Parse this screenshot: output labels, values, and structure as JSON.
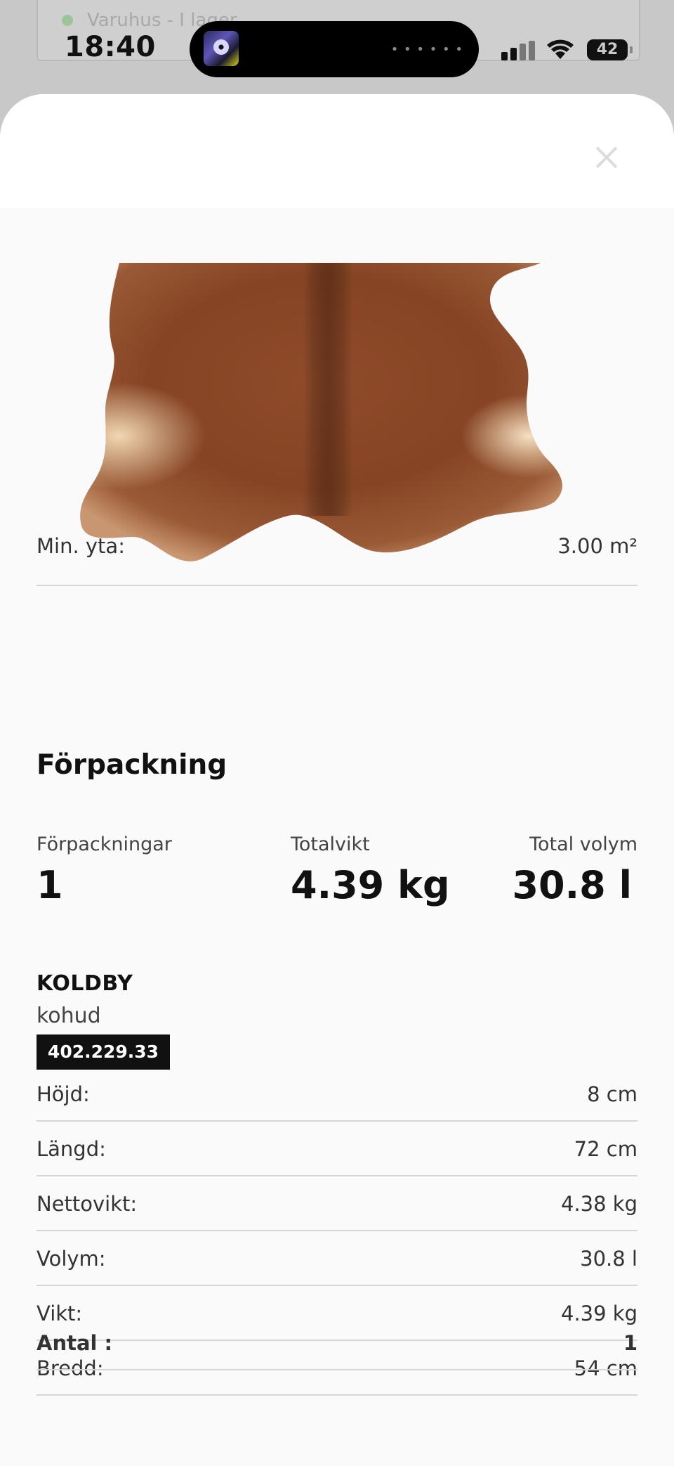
{
  "status_bar": {
    "time": "18:40",
    "battery": "42"
  },
  "background_page": {
    "stock_text": "Varuhus - I lager"
  },
  "min_area": {
    "label": "Min. yta:",
    "value": "3.00 m²"
  },
  "packaging": {
    "title": "Förpackning",
    "stats": [
      {
        "label": "Förpackningar",
        "value": "1"
      },
      {
        "label": "Totalvikt",
        "value": "4.39 kg"
      },
      {
        "label": "Total volym",
        "value": "30.8 l"
      }
    ]
  },
  "product": {
    "name": "KOLDBY",
    "type": "kohud",
    "article_number": "402.229.33",
    "specs": [
      {
        "label": "Höjd:",
        "value": "8 cm"
      },
      {
        "label": "Längd:",
        "value": "72 cm"
      },
      {
        "label": "Nettovikt:",
        "value": "4.38 kg"
      },
      {
        "label": "Volym:",
        "value": "30.8 l"
      },
      {
        "label": "Vikt:",
        "value": "4.39 kg"
      },
      {
        "label": "Bredd:",
        "value": "54 cm"
      }
    ],
    "quantity": {
      "label": "Antal :",
      "value": "1"
    }
  },
  "colors": {
    "hide_brown": "#8a4726",
    "hide_light": "#e8c9a1",
    "article_badge": "#111111"
  },
  "icons": [
    "close-icon",
    "signal-icon",
    "wifi-icon",
    "battery-icon"
  ]
}
